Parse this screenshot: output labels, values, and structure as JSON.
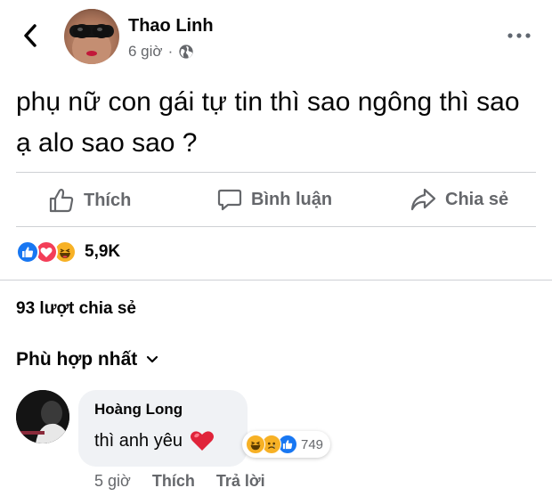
{
  "post": {
    "author_name": "Thao Linh",
    "time": "6 giờ",
    "separator": "·",
    "privacy_icon": "globe-icon",
    "text": "phụ nữ con gái tự tin thì sao ngông thì sao ạ alo sao sao ?"
  },
  "actions": {
    "like_label": "Thích",
    "comment_label": "Bình luận",
    "share_label": "Chia sẻ"
  },
  "reactions": {
    "types": [
      "like",
      "love",
      "haha"
    ],
    "count": "5,9K"
  },
  "shares": {
    "text": "93 lượt chia sẻ"
  },
  "comments": {
    "sort_label": "Phù hợp nhất",
    "items": [
      {
        "author": "Hoàng Long",
        "text": "thì anh yêu",
        "emoji": "heart",
        "reactions": [
          "haha",
          "sad",
          "like"
        ],
        "reaction_count": "749",
        "time": "5 giờ",
        "like_label": "Thích",
        "reply_label": "Trả lời"
      }
    ]
  },
  "colors": {
    "facebook_blue": "#1877f2",
    "love_red": "#f33e58",
    "haha_yellow": "#f7b125",
    "secondary_text": "#65676b",
    "bubble_bg": "#f0f2f5"
  }
}
